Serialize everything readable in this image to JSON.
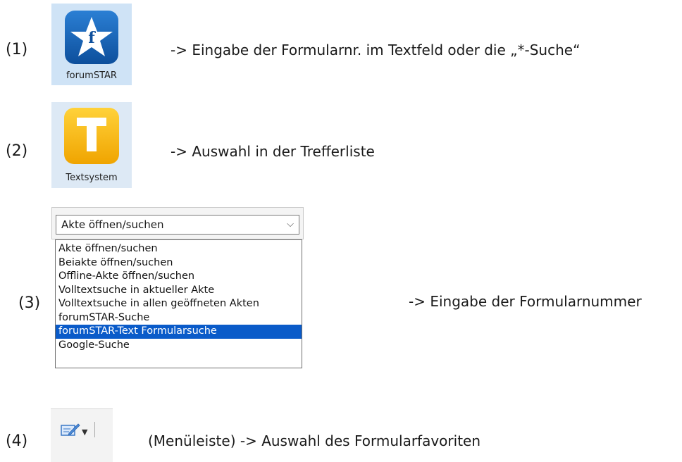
{
  "steps": [
    {
      "num": "(1)",
      "desc": "-> Eingabe der Formularnr. im Textfeld oder die „*-Suche“"
    },
    {
      "num": "(2)",
      "desc": "-> Auswahl in der Trefferliste"
    },
    {
      "num": "(3)",
      "desc": "-> Eingabe der Formularnummer"
    },
    {
      "num": "(4)",
      "desc": "(Menüleiste)  -> Auswahl des Formularfavoriten"
    }
  ],
  "apps": {
    "forumstar": {
      "label": "forumSTAR",
      "icon": "forumstar-star-icon",
      "color": "#1565c0"
    },
    "textsystem": {
      "label": "Textsystem",
      "icon": "textsystem-t-icon",
      "color": "#f5b400"
    }
  },
  "dropdown": {
    "selected": "Akte öffnen/suchen",
    "options": [
      "Akte öffnen/suchen",
      "Beiakte öffnen/suchen",
      "Offline-Akte öffnen/suchen",
      "Volltextsuche in aktueller Akte",
      "Volltextsuche in allen geöffneten Akten",
      "forumSTAR-Suche",
      "forumSTAR-Text Formularsuche",
      "Google-Suche"
    ],
    "highlighted_index": 6,
    "highlight_color": "#0a5bc9"
  },
  "menu_button": {
    "icon": "form-edit-icon",
    "caret": "chevron-down-icon"
  }
}
